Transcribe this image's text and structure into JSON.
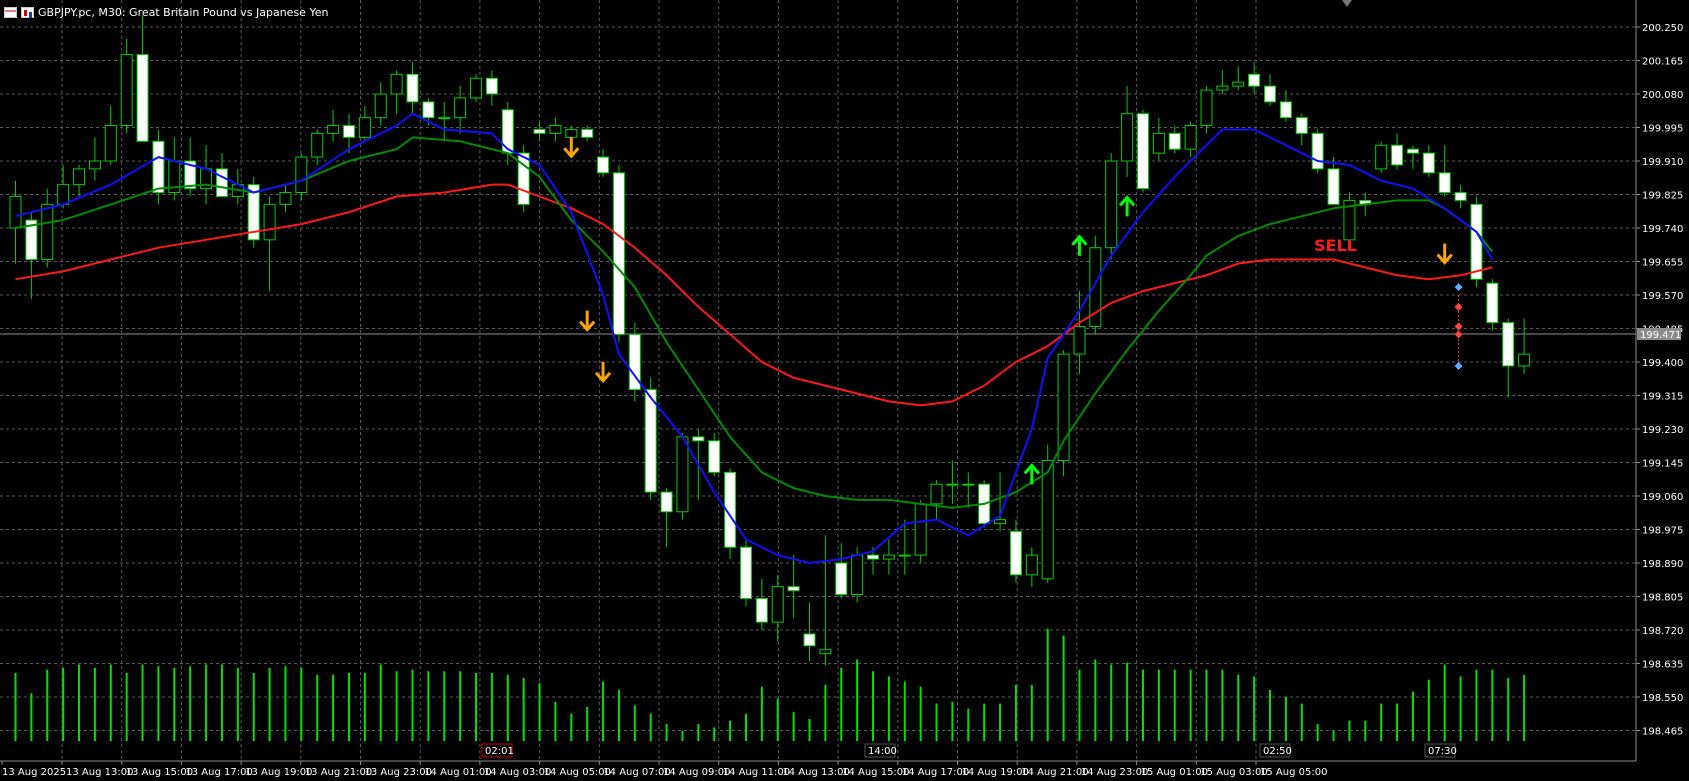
{
  "window": {
    "title": "GBPJPY.pc, M30:  Great Britain Pound vs Japanese Yen"
  },
  "colors": {
    "background": "#000000",
    "grid": "#5a5a5a",
    "candle_up_fill": "#000000",
    "candle_down_fill": "#ffffff",
    "candle_outline": "#00cc00",
    "volume": "#00e000",
    "ma_fast": "#1010ff",
    "ma_mid": "#008a00",
    "ma_slow": "#ff1a1a",
    "arrow_down": "#ffa500",
    "arrow_up": "#00ff00",
    "sell_text": "#ff1a1a",
    "bid_line": "#8c8c8c"
  },
  "chart_data": {
    "type": "candlestick",
    "symbol": "GBPJPY.pc",
    "timeframe": "M30",
    "ylim": [
      198.38,
      200.3
    ],
    "price_ticks": [
      "200.250",
      "200.165",
      "200.080",
      "199.995",
      "199.910",
      "199.825",
      "199.740",
      "199.655",
      "199.570",
      "199.485",
      "199.400",
      "199.315",
      "199.230",
      "199.145",
      "199.060",
      "198.975",
      "198.890",
      "198.805",
      "198.720",
      "198.635",
      "198.550",
      "198.465"
    ],
    "current_price": "199.471",
    "time_labels": [
      "13 Aug 2025",
      "13 Aug 13:00",
      "13 Aug 15:00",
      "13 Aug 17:00",
      "13 Aug 19:00",
      "13 Aug 21:00",
      "13 Aug 23:00",
      "14 Aug 01:00",
      "14 Aug 03:00",
      "14 Aug 05:00",
      "14 Aug 07:00",
      "14 Aug 09:00",
      "14 Aug 11:00",
      "14 Aug 13:00",
      "14 Aug 15:00",
      "14 Aug 17:00",
      "14 Aug 19:00",
      "14 Aug 21:00",
      "14 Aug 23:00",
      "15 Aug 01:00",
      "15 Aug 03:00",
      "15 Aug 05:00"
    ],
    "time_markers": [
      "02:01",
      "14:00",
      "02:50",
      "07:30"
    ],
    "candles": [
      {
        "o": 199.74,
        "h": 199.86,
        "l": 199.65,
        "c": 199.82
      },
      {
        "o": 199.76,
        "h": 199.78,
        "l": 199.56,
        "c": 199.66
      },
      {
        "o": 199.66,
        "h": 199.84,
        "l": 199.64,
        "c": 199.8
      },
      {
        "o": 199.8,
        "h": 199.9,
        "l": 199.79,
        "c": 199.85
      },
      {
        "o": 199.85,
        "h": 199.9,
        "l": 199.82,
        "c": 199.89
      },
      {
        "o": 199.89,
        "h": 199.97,
        "l": 199.86,
        "c": 199.91
      },
      {
        "o": 199.91,
        "h": 200.05,
        "l": 199.9,
        "c": 200.0
      },
      {
        "o": 200.0,
        "h": 200.22,
        "l": 199.98,
        "c": 200.18
      },
      {
        "o": 200.18,
        "h": 200.28,
        "l": 199.96,
        "c": 199.96
      },
      {
        "o": 199.96,
        "h": 199.99,
        "l": 199.8,
        "c": 199.83
      },
      {
        "o": 199.83,
        "h": 199.97,
        "l": 199.81,
        "c": 199.91
      },
      {
        "o": 199.91,
        "h": 199.97,
        "l": 199.82,
        "c": 199.84
      },
      {
        "o": 199.84,
        "h": 199.95,
        "l": 199.8,
        "c": 199.89
      },
      {
        "o": 199.89,
        "h": 199.93,
        "l": 199.82,
        "c": 199.82
      },
      {
        "o": 199.82,
        "h": 199.89,
        "l": 199.8,
        "c": 199.85
      },
      {
        "o": 199.85,
        "h": 199.87,
        "l": 199.69,
        "c": 199.71
      },
      {
        "o": 199.71,
        "h": 199.82,
        "l": 199.58,
        "c": 199.8
      },
      {
        "o": 199.8,
        "h": 199.85,
        "l": 199.78,
        "c": 199.83
      },
      {
        "o": 199.83,
        "h": 199.93,
        "l": 199.81,
        "c": 199.92
      },
      {
        "o": 199.92,
        "h": 199.99,
        "l": 199.9,
        "c": 199.98
      },
      {
        "o": 199.98,
        "h": 200.04,
        "l": 199.96,
        "c": 200.0
      },
      {
        "o": 200.0,
        "h": 200.03,
        "l": 199.93,
        "c": 199.97
      },
      {
        "o": 199.97,
        "h": 200.05,
        "l": 199.96,
        "c": 200.02
      },
      {
        "o": 200.02,
        "h": 200.11,
        "l": 200.0,
        "c": 200.08
      },
      {
        "o": 200.08,
        "h": 200.14,
        "l": 200.03,
        "c": 200.13
      },
      {
        "o": 200.13,
        "h": 200.16,
        "l": 200.03,
        "c": 200.06
      },
      {
        "o": 200.06,
        "h": 200.07,
        "l": 200.0,
        "c": 200.02
      },
      {
        "o": 200.02,
        "h": 200.06,
        "l": 199.96,
        "c": 200.02
      },
      {
        "o": 200.02,
        "h": 200.1,
        "l": 199.98,
        "c": 200.07
      },
      {
        "o": 200.07,
        "h": 200.13,
        "l": 200.06,
        "c": 200.12
      },
      {
        "o": 200.12,
        "h": 200.14,
        "l": 200.05,
        "c": 200.08
      },
      {
        "o": 200.04,
        "h": 200.06,
        "l": 199.9,
        "c": 199.93
      },
      {
        "o": 199.93,
        "h": 199.95,
        "l": 199.78,
        "c": 199.8
      },
      {
        "o": 199.99,
        "h": 200.01,
        "l": 199.96,
        "c": 199.98
      },
      {
        "o": 199.98,
        "h": 200.02,
        "l": 199.96,
        "c": 200.0
      },
      {
        "o": 199.97,
        "h": 200.0,
        "l": 199.93,
        "c": 199.99
      },
      {
        "o": 199.99,
        "h": 200.0,
        "l": 199.96,
        "c": 199.97
      },
      {
        "o": 199.92,
        "h": 199.94,
        "l": 199.87,
        "c": 199.88
      },
      {
        "o": 199.88,
        "h": 199.9,
        "l": 199.45,
        "c": 199.47
      },
      {
        "o": 199.47,
        "h": 199.5,
        "l": 199.3,
        "c": 199.33
      },
      {
        "o": 199.33,
        "h": 199.36,
        "l": 199.05,
        "c": 199.07
      },
      {
        "o": 199.07,
        "h": 199.08,
        "l": 198.93,
        "c": 199.02
      },
      {
        "o": 199.02,
        "h": 199.22,
        "l": 199.0,
        "c": 199.21
      },
      {
        "o": 199.21,
        "h": 199.23,
        "l": 199.05,
        "c": 199.2
      },
      {
        "o": 199.2,
        "h": 199.22,
        "l": 199.11,
        "c": 199.12
      },
      {
        "o": 199.12,
        "h": 199.13,
        "l": 198.9,
        "c": 198.93
      },
      {
        "o": 198.93,
        "h": 198.95,
        "l": 198.78,
        "c": 198.8
      },
      {
        "o": 198.8,
        "h": 198.85,
        "l": 198.72,
        "c": 198.74
      },
      {
        "o": 198.74,
        "h": 198.86,
        "l": 198.69,
        "c": 198.83
      },
      {
        "o": 198.83,
        "h": 198.91,
        "l": 198.75,
        "c": 198.82
      },
      {
        "o": 198.71,
        "h": 198.79,
        "l": 198.64,
        "c": 198.68
      },
      {
        "o": 198.66,
        "h": 198.96,
        "l": 198.63,
        "c": 198.67
      },
      {
        "o": 198.89,
        "h": 198.94,
        "l": 198.8,
        "c": 198.81
      },
      {
        "o": 198.81,
        "h": 198.93,
        "l": 198.79,
        "c": 198.91
      },
      {
        "o": 198.91,
        "h": 198.93,
        "l": 198.86,
        "c": 198.9
      },
      {
        "o": 198.9,
        "h": 198.95,
        "l": 198.86,
        "c": 198.91
      },
      {
        "o": 198.91,
        "h": 199.0,
        "l": 198.86,
        "c": 198.91
      },
      {
        "o": 198.91,
        "h": 199.05,
        "l": 198.89,
        "c": 199.04
      },
      {
        "o": 199.04,
        "h": 199.1,
        "l": 199.0,
        "c": 199.09
      },
      {
        "o": 199.09,
        "h": 199.15,
        "l": 199.04,
        "c": 199.09
      },
      {
        "o": 199.09,
        "h": 199.12,
        "l": 199.03,
        "c": 199.09
      },
      {
        "o": 199.09,
        "h": 199.1,
        "l": 198.98,
        "c": 198.99
      },
      {
        "o": 198.99,
        "h": 199.12,
        "l": 198.97,
        "c": 199.0
      },
      {
        "o": 198.97,
        "h": 199.0,
        "l": 198.84,
        "c": 198.86
      },
      {
        "o": 198.86,
        "h": 198.93,
        "l": 198.83,
        "c": 198.91
      },
      {
        "o": 198.85,
        "h": 199.19,
        "l": 198.84,
        "c": 199.15
      },
      {
        "o": 199.15,
        "h": 199.43,
        "l": 199.11,
        "c": 199.42
      },
      {
        "o": 199.42,
        "h": 199.58,
        "l": 199.37,
        "c": 199.49
      },
      {
        "o": 199.49,
        "h": 199.72,
        "l": 199.47,
        "c": 199.69
      },
      {
        "o": 199.69,
        "h": 199.93,
        "l": 199.66,
        "c": 199.91
      },
      {
        "o": 199.91,
        "h": 200.1,
        "l": 199.87,
        "c": 200.03
      },
      {
        "o": 200.03,
        "h": 200.04,
        "l": 199.83,
        "c": 199.84
      },
      {
        "o": 199.93,
        "h": 200.02,
        "l": 199.91,
        "c": 199.98
      },
      {
        "o": 199.98,
        "h": 200.0,
        "l": 199.93,
        "c": 199.94
      },
      {
        "o": 199.94,
        "h": 200.01,
        "l": 199.92,
        "c": 200.0
      },
      {
        "o": 200.0,
        "h": 200.1,
        "l": 199.98,
        "c": 200.09
      },
      {
        "o": 200.09,
        "h": 200.14,
        "l": 200.08,
        "c": 200.1
      },
      {
        "o": 200.1,
        "h": 200.15,
        "l": 200.09,
        "c": 200.11
      },
      {
        "o": 200.13,
        "h": 200.16,
        "l": 200.08,
        "c": 200.1
      },
      {
        "o": 200.1,
        "h": 200.13,
        "l": 200.05,
        "c": 200.06
      },
      {
        "o": 200.06,
        "h": 200.09,
        "l": 200.01,
        "c": 200.02
      },
      {
        "o": 200.02,
        "h": 200.03,
        "l": 199.95,
        "c": 199.98
      },
      {
        "o": 199.98,
        "h": 199.99,
        "l": 199.88,
        "c": 199.89
      },
      {
        "o": 199.89,
        "h": 199.92,
        "l": 199.8,
        "c": 199.8
      },
      {
        "o": 199.71,
        "h": 199.83,
        "l": 199.7,
        "c": 199.81
      },
      {
        "o": 199.81,
        "h": 199.83,
        "l": 199.77,
        "c": 199.8
      },
      {
        "o": 199.89,
        "h": 199.96,
        "l": 199.88,
        "c": 199.95
      },
      {
        "o": 199.95,
        "h": 199.98,
        "l": 199.89,
        "c": 199.9
      },
      {
        "o": 199.94,
        "h": 199.95,
        "l": 199.89,
        "c": 199.93
      },
      {
        "o": 199.93,
        "h": 199.95,
        "l": 199.87,
        "c": 199.88
      },
      {
        "o": 199.88,
        "h": 199.95,
        "l": 199.82,
        "c": 199.83
      },
      {
        "o": 199.83,
        "h": 199.85,
        "l": 199.79,
        "c": 199.81
      },
      {
        "o": 199.8,
        "h": 199.82,
        "l": 199.59,
        "c": 199.61
      },
      {
        "o": 199.6,
        "h": 199.61,
        "l": 199.48,
        "c": 199.5
      },
      {
        "o": 199.5,
        "h": 199.51,
        "l": 199.31,
        "c": 199.39
      },
      {
        "o": 199.39,
        "h": 199.51,
        "l": 199.37,
        "c": 199.42
      }
    ],
    "volumes": [
      0.4,
      0.28,
      0.42,
      0.43,
      0.45,
      0.43,
      0.45,
      0.4,
      0.45,
      0.44,
      0.43,
      0.44,
      0.45,
      0.45,
      0.43,
      0.4,
      0.43,
      0.44,
      0.43,
      0.39,
      0.39,
      0.4,
      0.4,
      0.45,
      0.41,
      0.42,
      0.41,
      0.41,
      0.41,
      0.4,
      0.4,
      0.39,
      0.37,
      0.34,
      0.23,
      0.16,
      0.2,
      0.35,
      0.3,
      0.21,
      0.16,
      0.1,
      0.06,
      0.1,
      0.08,
      0.12,
      0.16,
      0.32,
      0.25,
      0.17,
      0.13,
      0.33,
      0.43,
      0.48,
      0.41,
      0.38,
      0.35,
      0.32,
      0.22,
      0.23,
      0.19,
      0.22,
      0.22,
      0.33,
      0.33,
      0.66,
      0.62,
      0.42,
      0.48,
      0.45,
      0.46,
      0.42,
      0.42,
      0.42,
      0.42,
      0.42,
      0.42,
      0.39,
      0.38,
      0.3,
      0.26,
      0.22,
      0.1,
      0.06,
      0.12,
      0.12,
      0.22,
      0.22,
      0.29,
      0.36,
      0.45,
      0.38,
      0.42,
      0.42,
      0.37,
      0.39
    ],
    "ma_fast": [
      [
        0,
        199.77
      ],
      [
        3,
        199.8
      ],
      [
        6,
        199.85
      ],
      [
        9,
        199.92
      ],
      [
        12,
        199.89
      ],
      [
        15,
        199.83
      ],
      [
        18,
        199.86
      ],
      [
        21,
        199.94
      ],
      [
        24,
        200.0
      ],
      [
        25,
        200.03
      ],
      [
        27,
        199.99
      ],
      [
        30,
        199.98
      ],
      [
        31,
        199.94
      ],
      [
        33,
        199.9
      ],
      [
        35,
        199.78
      ],
      [
        37,
        199.57
      ],
      [
        38,
        199.42
      ],
      [
        40,
        199.31
      ],
      [
        42,
        199.21
      ],
      [
        44,
        199.07
      ],
      [
        46,
        198.95
      ],
      [
        48,
        198.91
      ],
      [
        50,
        198.89
      ],
      [
        52,
        198.9
      ],
      [
        54,
        198.92
      ],
      [
        56,
        198.99
      ],
      [
        58,
        199.0
      ],
      [
        60,
        198.96
      ],
      [
        62,
        199.01
      ],
      [
        64,
        199.23
      ],
      [
        65,
        199.41
      ],
      [
        67,
        199.53
      ],
      [
        69,
        199.67
      ],
      [
        71,
        199.78
      ],
      [
        73,
        199.87
      ],
      [
        75,
        199.95
      ],
      [
        76,
        199.99
      ],
      [
        78,
        199.99
      ],
      [
        79,
        199.97
      ],
      [
        80,
        199.95
      ],
      [
        82,
        199.91
      ],
      [
        84,
        199.9
      ],
      [
        86,
        199.86
      ],
      [
        88,
        199.84
      ],
      [
        90,
        199.79
      ],
      [
        92,
        199.73
      ],
      [
        93,
        199.66
      ]
    ],
    "ma_mid": [
      [
        0,
        199.74
      ],
      [
        3,
        199.76
      ],
      [
        6,
        199.8
      ],
      [
        9,
        199.84
      ],
      [
        12,
        199.85
      ],
      [
        15,
        199.83
      ],
      [
        18,
        199.86
      ],
      [
        21,
        199.91
      ],
      [
        24,
        199.94
      ],
      [
        25,
        199.97
      ],
      [
        28,
        199.96
      ],
      [
        31,
        199.93
      ],
      [
        33,
        199.87
      ],
      [
        35,
        199.76
      ],
      [
        37,
        199.68
      ],
      [
        39,
        199.59
      ],
      [
        41,
        199.45
      ],
      [
        43,
        199.33
      ],
      [
        45,
        199.21
      ],
      [
        47,
        199.12
      ],
      [
        49,
        199.08
      ],
      [
        51,
        199.06
      ],
      [
        53,
        199.05
      ],
      [
        55,
        199.05
      ],
      [
        57,
        199.04
      ],
      [
        59,
        199.03
      ],
      [
        61,
        199.04
      ],
      [
        63,
        199.07
      ],
      [
        65,
        199.12
      ],
      [
        66,
        199.2
      ],
      [
        68,
        199.32
      ],
      [
        70,
        199.43
      ],
      [
        72,
        199.53
      ],
      [
        74,
        199.62
      ],
      [
        75,
        199.67
      ],
      [
        77,
        199.72
      ],
      [
        79,
        199.75
      ],
      [
        81,
        199.77
      ],
      [
        83,
        199.79
      ],
      [
        85,
        199.8
      ],
      [
        87,
        199.81
      ],
      [
        89,
        199.81
      ],
      [
        90,
        199.79
      ],
      [
        92,
        199.73
      ],
      [
        93,
        199.68
      ]
    ],
    "ma_slow": [
      [
        0,
        199.61
      ],
      [
        3,
        199.63
      ],
      [
        6,
        199.66
      ],
      [
        9,
        199.69
      ],
      [
        12,
        199.71
      ],
      [
        15,
        199.73
      ],
      [
        18,
        199.75
      ],
      [
        21,
        199.78
      ],
      [
        24,
        199.82
      ],
      [
        27,
        199.83
      ],
      [
        30,
        199.85
      ],
      [
        31,
        199.85
      ],
      [
        33,
        199.82
      ],
      [
        35,
        199.79
      ],
      [
        37,
        199.75
      ],
      [
        39,
        199.69
      ],
      [
        41,
        199.62
      ],
      [
        43,
        199.54
      ],
      [
        45,
        199.47
      ],
      [
        47,
        199.4
      ],
      [
        49,
        199.36
      ],
      [
        51,
        199.34
      ],
      [
        53,
        199.32
      ],
      [
        55,
        199.3
      ],
      [
        57,
        199.29
      ],
      [
        59,
        199.3
      ],
      [
        61,
        199.34
      ],
      [
        63,
        199.4
      ],
      [
        65,
        199.44
      ],
      [
        67,
        199.5
      ],
      [
        69,
        199.55
      ],
      [
        71,
        199.58
      ],
      [
        73,
        199.6
      ],
      [
        75,
        199.62
      ],
      [
        77,
        199.65
      ],
      [
        79,
        199.66
      ],
      [
        81,
        199.66
      ],
      [
        83,
        199.66
      ],
      [
        85,
        199.64
      ],
      [
        87,
        199.62
      ],
      [
        89,
        199.61
      ],
      [
        91,
        199.62
      ],
      [
        93,
        199.64
      ]
    ],
    "signals": [
      {
        "type": "down",
        "bar": 35,
        "price": 199.94
      },
      {
        "type": "down",
        "bar": 36,
        "price": 199.5
      },
      {
        "type": "down",
        "bar": 37,
        "price": 199.37
      },
      {
        "type": "up",
        "bar": 64,
        "price": 199.12
      },
      {
        "type": "up",
        "bar": 67,
        "price": 199.7
      },
      {
        "type": "up",
        "bar": 70,
        "price": 199.8
      },
      {
        "type": "down",
        "bar": 90,
        "price": 199.67
      }
    ],
    "sell_label": "SELL"
  }
}
